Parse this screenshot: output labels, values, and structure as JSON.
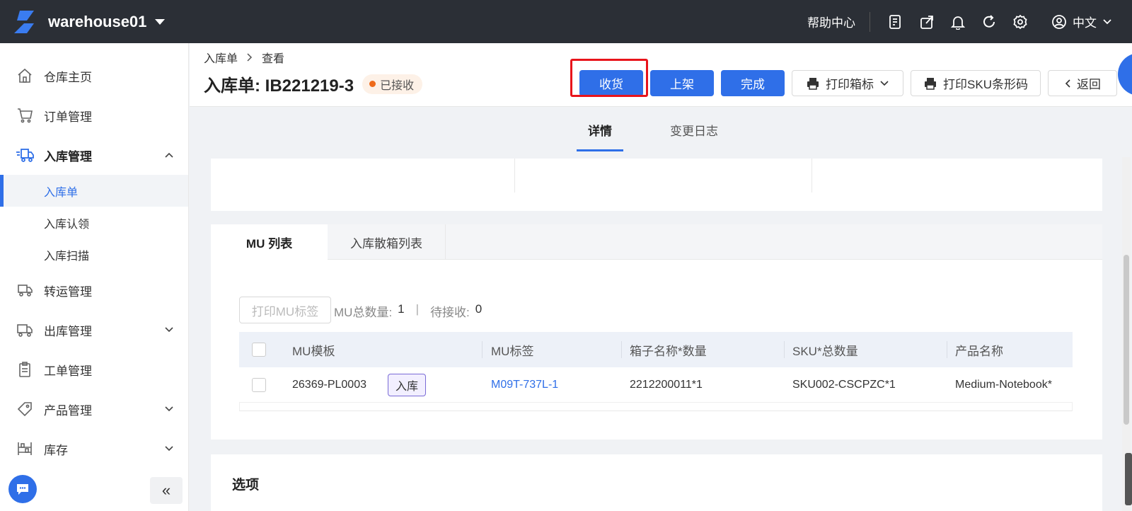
{
  "topbar": {
    "warehouse": "warehouse01",
    "help": "帮助中心",
    "language": "中文",
    "icons": [
      "notes-icon",
      "export-icon",
      "bell-icon",
      "refresh-icon",
      "gear-icon"
    ]
  },
  "sidebar": {
    "items": [
      {
        "label": "仓库主页",
        "icon": "home-icon"
      },
      {
        "label": "订单管理",
        "icon": "cart-icon"
      },
      {
        "label": "入库管理",
        "icon": "inbound-truck-icon",
        "expanded": true
      },
      {
        "label": "转运管理",
        "icon": "transfer-icon"
      },
      {
        "label": "出库管理",
        "icon": "outbound-truck-icon"
      },
      {
        "label": "工单管理",
        "icon": "clipboard-icon"
      },
      {
        "label": "产品管理",
        "icon": "tag-icon"
      },
      {
        "label": "库存",
        "icon": "shelf-icon"
      }
    ],
    "sub_items": [
      "入库单",
      "入库认领",
      "入库扫描"
    ],
    "collapse": "«"
  },
  "header": {
    "breadcrumb": [
      "入库单",
      "查看"
    ],
    "title": "入库单: IB221219-3",
    "status": "已接收",
    "buttons": {
      "receive": "收货",
      "shelve": "上架",
      "complete": "完成",
      "print_box": "打印箱标",
      "print_sku": "打印SKU条形码",
      "back": "返回"
    }
  },
  "tabs": [
    "详情",
    "变更日志"
  ],
  "mu": {
    "tabs": [
      "MU 列表",
      "入库散箱列表"
    ],
    "print_button": "打印MU标签",
    "total_label": "MU总数量:",
    "total_value": "1",
    "pending_label": "待接收:",
    "pending_value": "0",
    "sep": "|",
    "columns": [
      "MU模板",
      "MU标签",
      "箱子名称*数量",
      "SKU*总数量",
      "产品名称"
    ],
    "rows": [
      {
        "template": "26369-PL0003",
        "tag": "入库",
        "label": "M09T-737L-1",
        "box": "2212200011*1",
        "sku": "SKU002-CSCPZC*1",
        "product": "Medium-Notebook*"
      }
    ]
  },
  "options": {
    "title": "选项"
  },
  "colors": {
    "primary": "#2f6fe8",
    "topbar": "#2b2f36",
    "status_dot": "#ee6a1a",
    "highlight": "#e8141b"
  }
}
